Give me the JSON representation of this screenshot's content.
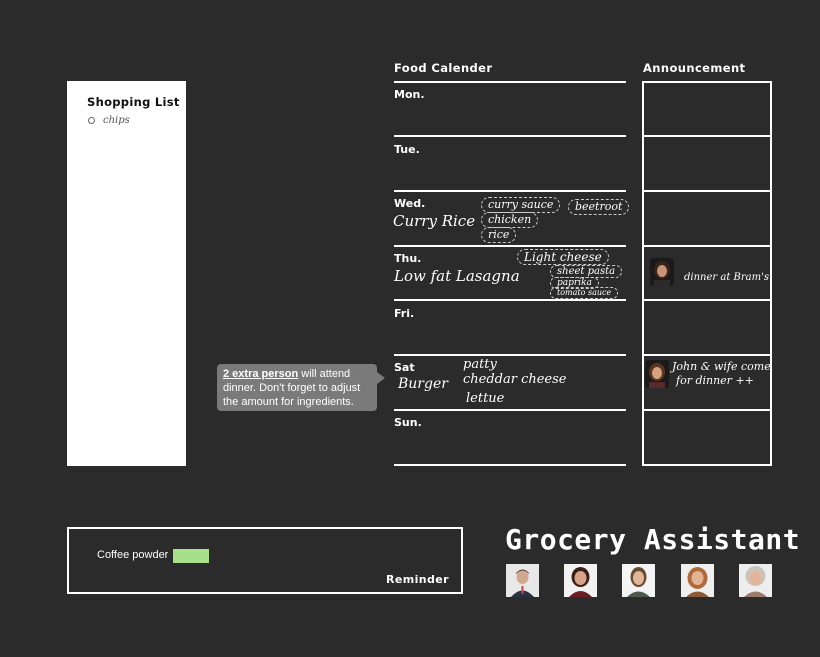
{
  "app": {
    "title": "Grocery Assistant"
  },
  "shopping_list": {
    "title": "Shopping List",
    "items": [
      "chips"
    ]
  },
  "food_calendar": {
    "title": "Food Calender",
    "days": [
      {
        "label": "Mon.",
        "meal": "",
        "ingredients": []
      },
      {
        "label": "Tue.",
        "meal": "",
        "ingredients": []
      },
      {
        "label": "Wed.",
        "meal": "Curry Rice",
        "ingredients": [
          "curry sauce",
          "beetroot",
          "chicken",
          "rice"
        ]
      },
      {
        "label": "Thu.",
        "meal": "Low fat Lasagna",
        "ingredients": [
          "Light cheese",
          "sheet pasta",
          "paprika",
          "tomato sauce"
        ]
      },
      {
        "label": "Fri.",
        "meal": "",
        "ingredients": []
      },
      {
        "label": "Sat",
        "meal": "Burger",
        "ingredients": [
          "patty",
          "cheddar cheese",
          "lettue"
        ]
      },
      {
        "label": "Sun.",
        "meal": "",
        "ingredients": []
      }
    ]
  },
  "announcement": {
    "title": "Announcement",
    "entries": [
      {
        "text": "dinner at Bram's"
      },
      {
        "line1": "John & wife come",
        "line2": "for dinner ++"
      }
    ]
  },
  "tooltip": {
    "emphasis": "2 extra person",
    "text": " will attend dinner. Don't forget to adjust the amount for ingredients."
  },
  "reminder": {
    "label": "Reminder",
    "items": [
      "Coffee powder"
    ],
    "highlight_color": "#a8e08a"
  },
  "colors": {
    "background": "#2b2b2b",
    "foreground": "#ffffff",
    "tooltip": "#7a7a7a"
  }
}
